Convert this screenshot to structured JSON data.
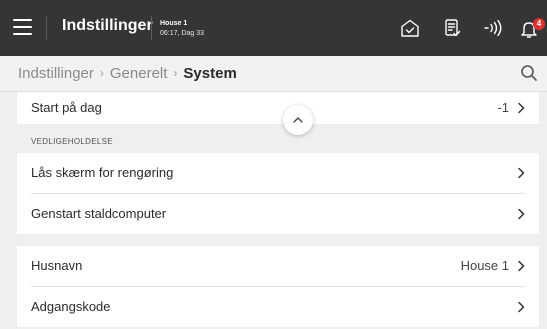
{
  "topbar": {
    "title": "Indstillinger",
    "house_name": "House 1",
    "house_time": "06:17, Dag 33",
    "notification_count": "4",
    "icons": [
      "menu-icon",
      "house-check-icon",
      "report-icon",
      "signal-icon",
      "bell-icon"
    ]
  },
  "breadcrumb": {
    "items": [
      "Indstillinger",
      "Generelt",
      "System"
    ],
    "separator": "›"
  },
  "card1": {
    "rows": [
      {
        "label": "Start på dag",
        "value": "-1"
      }
    ]
  },
  "section": {
    "header": "VEDLIGEHOLDELSE"
  },
  "card2": {
    "rows": [
      {
        "label": "Lås skærm for rengøring",
        "value": ""
      },
      {
        "label": "Genstart staldcomputer",
        "value": ""
      }
    ]
  },
  "card3": {
    "rows": [
      {
        "label": "Husnavn",
        "value": "House 1"
      },
      {
        "label": "Adgangskode",
        "value": ""
      }
    ]
  },
  "colors": {
    "topbar": "#353535",
    "background": "#efefef",
    "badge": "#e03131",
    "card": "#ffffff"
  }
}
